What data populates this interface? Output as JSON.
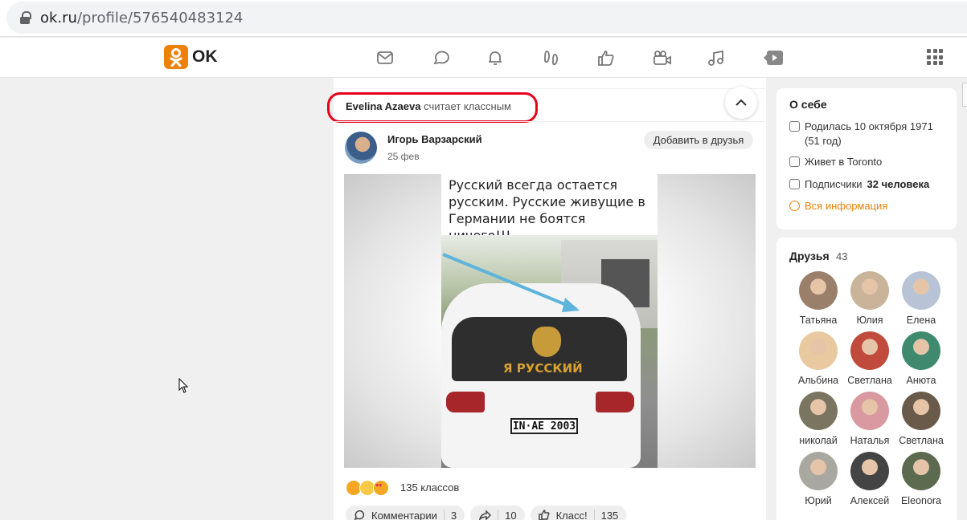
{
  "browser": {
    "url_host": "ok.ru",
    "url_path": "/profile/576540483124"
  },
  "nav": {
    "logo_text": "OK",
    "brand_color": "#ee8208",
    "icons": [
      "messages-icon",
      "discussions-icon",
      "notifications-icon",
      "guests-icon",
      "likes-icon",
      "video-icon",
      "music-icon",
      "video-play-icon"
    ]
  },
  "feed": {
    "liked_by_name": "Evelina Azaeva",
    "liked_by_action": "считает классным",
    "author_name": "Игорь Варзарский",
    "post_date": "25 фев",
    "add_friend_label": "Добавить в друзья",
    "image_caption": "Русский всегда остается русским. Русские живущие в Германии не боятся ничего!!!",
    "car_sticker_text": "Я РУССКИЙ",
    "car_plate": "IN·AE 2003",
    "reactions_count": "135 классов",
    "actions": {
      "comments_label": "Комментарии",
      "comments_count": "3",
      "shares_count": "10",
      "class_label": "Класс!",
      "class_count": "135"
    }
  },
  "about": {
    "title": "О себе",
    "birth_line": "Родилась 10 октября 1971 (51 год)",
    "lives": "Живет в Toronto",
    "subscribers_prefix": "Подписчики",
    "subscribers_count": "32 человека",
    "all_info_link": "Вся информация"
  },
  "friends": {
    "title": "Друзья",
    "count": "43",
    "items": [
      {
        "name": "Татьяна",
        "color": "#9a7f6a"
      },
      {
        "name": "Юлия",
        "color": "#c9b49a"
      },
      {
        "name": "Елена",
        "color": "#b8c4d6"
      },
      {
        "name": "Альбина",
        "color": "#e8c9a0"
      },
      {
        "name": "Светлана",
        "color": "#c04a3c"
      },
      {
        "name": "Анюта",
        "color": "#3f8a6e"
      },
      {
        "name": "николай",
        "color": "#7a7560"
      },
      {
        "name": "Наталья",
        "color": "#d89aa0"
      },
      {
        "name": "Светлана",
        "color": "#6a5a4a"
      },
      {
        "name": "Юрий",
        "color": "#a8a8a0"
      },
      {
        "name": "Алексей",
        "color": "#444444"
      },
      {
        "name": "Eleonora",
        "color": "#5c6a50"
      }
    ]
  }
}
